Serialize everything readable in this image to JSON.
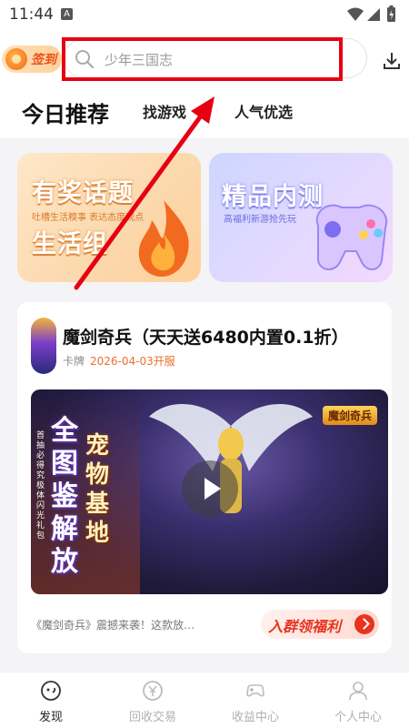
{
  "status_bar": {
    "time": "11:44",
    "notification_letter": "A"
  },
  "header": {
    "checkin_label": "签到",
    "search_placeholder": "少年三国志"
  },
  "tabs": [
    {
      "label": "今日推荐"
    },
    {
      "label": "找游戏"
    },
    {
      "label": "人气优选"
    }
  ],
  "banners": {
    "left": {
      "title_line1": "有奖话题",
      "subtitle": "吐槽生活糗事 表达态度观点",
      "title_line2": "生活组"
    },
    "right": {
      "title": "精品内测",
      "subtitle": "高福利新游抢先玩"
    }
  },
  "game_card": {
    "title": "魔剑奇兵（天天送6480内置0.1折）",
    "category": "卡牌",
    "open_date": "2026-04-03开服",
    "video": {
      "poster_text_main": "全图鉴解放",
      "poster_text_side": "宠物基地",
      "poster_text_small": "首抽必得究极体闪光礼包",
      "logo_text": "魔剑奇兵"
    },
    "description": "《魔剑奇兵》震撼来袭！这款放…",
    "group_button_label": "入群领福利"
  },
  "bottom_nav": [
    {
      "label": "发现",
      "icon": "discover-icon",
      "active": true
    },
    {
      "label": "回收交易",
      "icon": "yuan-coin-icon",
      "active": false
    },
    {
      "label": "收益中心",
      "icon": "gamepad-icon",
      "active": false
    },
    {
      "label": "个人中心",
      "icon": "person-icon",
      "active": false
    }
  ],
  "colors": {
    "highlight_box": "#e60012",
    "accent_orange": "#e8712e",
    "accent_red": "#e8341e"
  }
}
